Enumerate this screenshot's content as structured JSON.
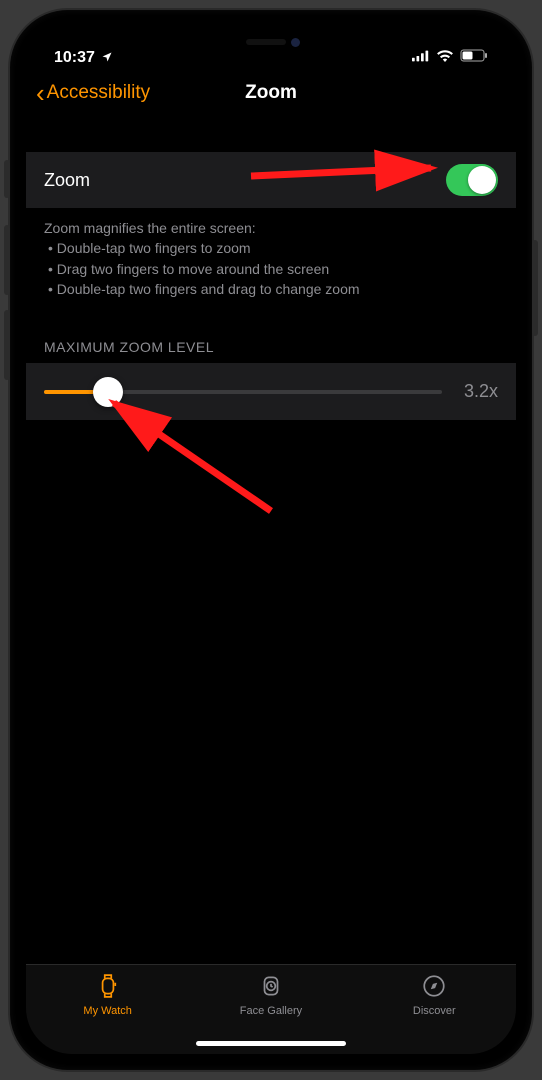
{
  "status": {
    "time": "10:37",
    "location_icon": "location-arrow",
    "battery_level": 0.45
  },
  "nav": {
    "back_label": "Accessibility",
    "title": "Zoom"
  },
  "zoom_cell": {
    "label": "Zoom",
    "enabled": true
  },
  "hint": {
    "header": "Zoom magnifies the entire screen:",
    "bullets": [
      "Double-tap two fingers to zoom",
      "Drag two fingers to move around the screen",
      "Double-tap two fingers and drag to change zoom"
    ]
  },
  "slider_section": {
    "title": "MAXIMUM ZOOM LEVEL",
    "value_label": "3.2x",
    "percent": 16
  },
  "tabs": {
    "items": [
      {
        "label": "My Watch",
        "icon": "watch-icon",
        "active": true
      },
      {
        "label": "Face Gallery",
        "icon": "watch-face-icon",
        "active": false
      },
      {
        "label": "Discover",
        "icon": "compass-icon",
        "active": false
      }
    ]
  },
  "colors": {
    "accent": "#ff9500",
    "toggle_on": "#34c759",
    "secondary_text": "#8e8e93",
    "cell_bg": "#1c1c1e"
  }
}
